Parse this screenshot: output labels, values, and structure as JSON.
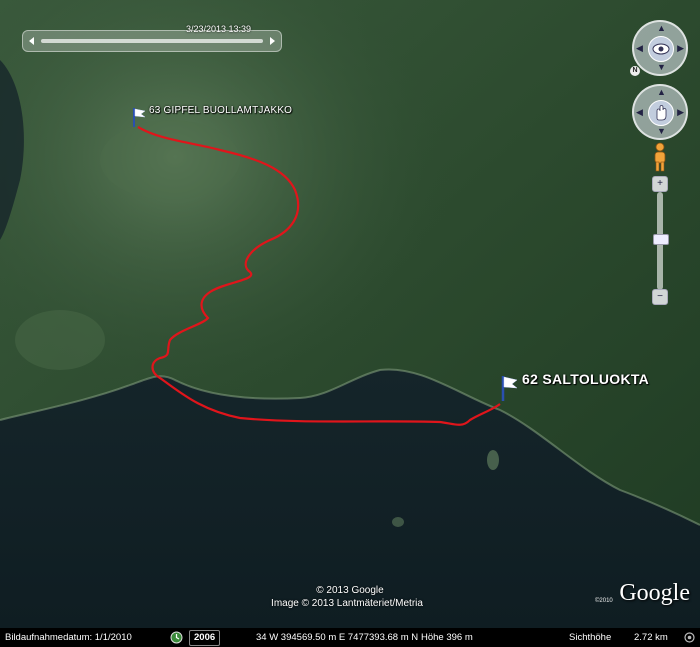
{
  "map": {
    "places": [
      {
        "name": "63 GIPFEL BUOLLAMTJAKKO"
      },
      {
        "name": "62 SALTOLUOKTA"
      }
    ],
    "route_color": "#e0151b",
    "flag_color": "#ffffff"
  },
  "time_slider": {
    "label": "3/23/2013  13:39"
  },
  "copyright": {
    "line1": "© 2013 Google",
    "line2": "Image © 2013 Lantmäteriet/Metria"
  },
  "branding": {
    "logo": "Google",
    "logo_year": "©2010"
  },
  "navigation": {
    "look_icon": "look-eye-icon",
    "move_icon": "move-hand-icon",
    "north_label": "N",
    "zoom_in": "+",
    "zoom_out": "−",
    "zoom_level": 0.46
  },
  "status_bar": {
    "date_label": "Bildaufnahmedatum: 1/1/2010",
    "historical_year": "2006",
    "coordinates": "34 W 394569.50 m E 7477393.68 m N",
    "elevation": "Höhe  396 m",
    "eye_alt_label": "Sichthöhe",
    "eye_alt_value": "2.72 km"
  }
}
